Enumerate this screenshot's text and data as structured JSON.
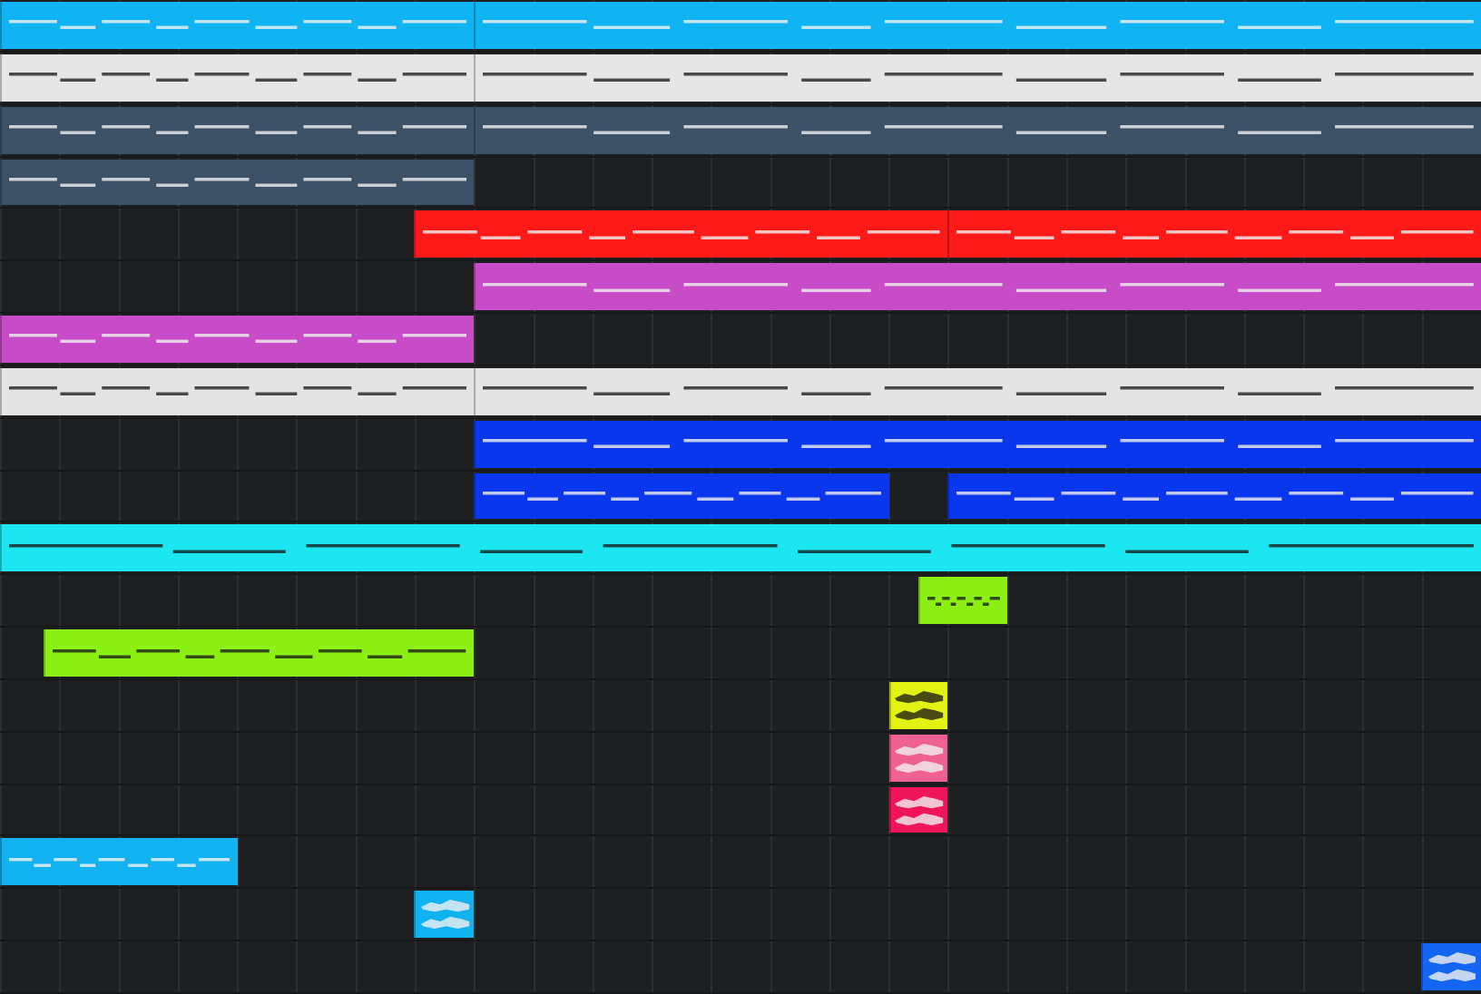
{
  "tracks": [
    {
      "clips": [
        {
          "kind": "midi",
          "color": "#10b4f2"
        },
        {
          "kind": "midi",
          "color": "#10b4f2"
        }
      ]
    },
    {
      "clips": [
        {
          "kind": "midi",
          "color": "#e6e6e6"
        },
        {
          "kind": "midi",
          "color": "#e6e6e6"
        }
      ]
    },
    {
      "clips": [
        {
          "kind": "midi",
          "color": "#3d5166"
        },
        {
          "kind": "midi",
          "color": "#3d5166"
        }
      ]
    },
    {
      "clips": [
        {
          "kind": "midi",
          "color": "#3d5166"
        }
      ]
    },
    {
      "clips": [
        {
          "kind": "midi",
          "color": "#ff1a1a"
        },
        {
          "kind": "midi",
          "color": "#ff1a1a"
        }
      ]
    },
    {
      "clips": [
        {
          "kind": "midi",
          "color": "#c84cc8"
        }
      ]
    },
    {
      "clips": [
        {
          "kind": "midi",
          "color": "#c84cc8"
        }
      ]
    },
    {
      "clips": [
        {
          "kind": "midi",
          "color": "#e4e4e4"
        },
        {
          "kind": "midi",
          "color": "#e4e4e4"
        }
      ]
    },
    {
      "clips": [
        {
          "kind": "midi",
          "color": "#0a36ee"
        }
      ]
    },
    {
      "clips": [
        {
          "kind": "midi",
          "color": "#0a36ee"
        },
        {
          "kind": "midi",
          "color": "#0a36ee"
        }
      ]
    },
    {
      "clips": [
        {
          "kind": "midi",
          "color": "#1ce6f0"
        }
      ]
    },
    {
      "clips": [
        {
          "kind": "midi",
          "color": "#8cf014"
        }
      ]
    },
    {
      "clips": [
        {
          "kind": "midi",
          "color": "#8cf014"
        }
      ]
    },
    {
      "clips": [
        {
          "kind": "audio",
          "color": "#e2f212"
        }
      ]
    },
    {
      "clips": [
        {
          "kind": "audio",
          "color": "#f06092"
        }
      ]
    },
    {
      "clips": [
        {
          "kind": "audio",
          "color": "#f0145a"
        }
      ]
    },
    {
      "clips": [
        {
          "kind": "midi",
          "color": "#12b2f0"
        }
      ]
    },
    {
      "clips": [
        {
          "kind": "audio",
          "color": "#12b2f0"
        }
      ]
    },
    {
      "clips": [
        {
          "kind": "audio",
          "color": "#1466f2"
        }
      ]
    }
  ]
}
